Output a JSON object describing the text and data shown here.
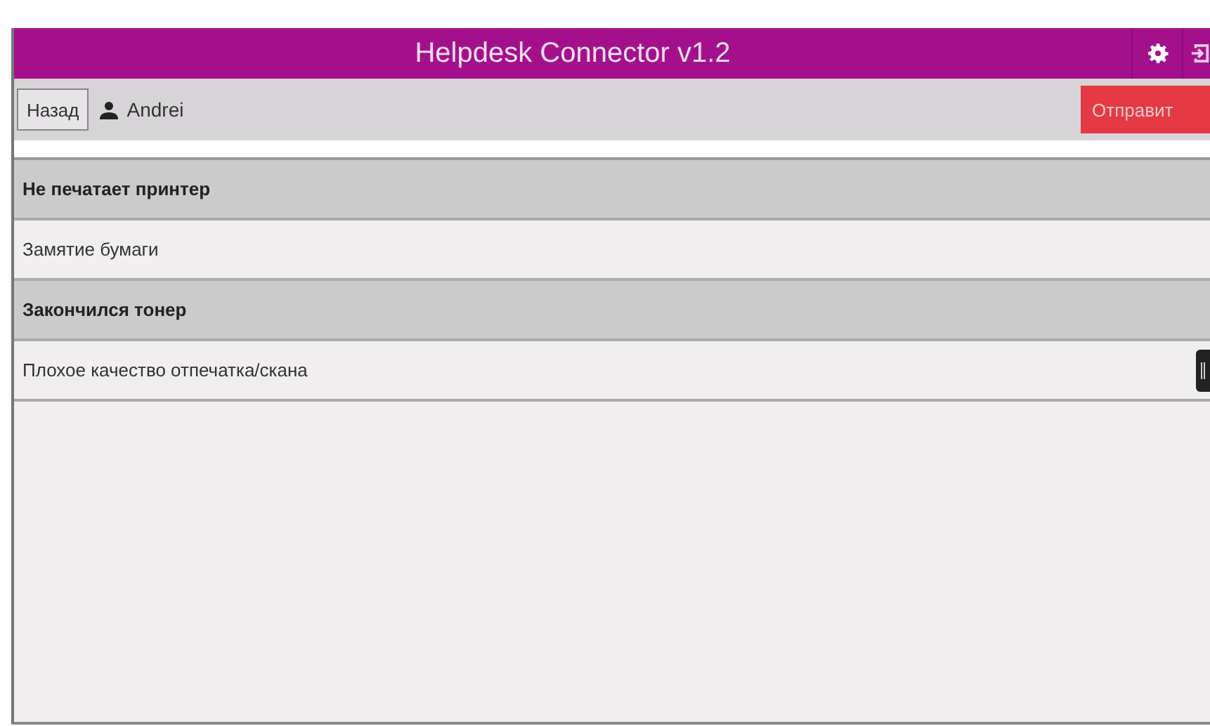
{
  "header": {
    "title": "Helpdesk Connector v1.2"
  },
  "toolbar": {
    "back": "Назад",
    "user": "Andrei",
    "send": "Отправит"
  },
  "items": [
    {
      "label": "Не печатает принтер",
      "selected": true
    },
    {
      "label": "Замятие бумаги",
      "selected": false
    },
    {
      "label": "Закончился тонер",
      "selected": true
    },
    {
      "label": "Плохое качество отпечатка/скана",
      "selected": false
    }
  ]
}
